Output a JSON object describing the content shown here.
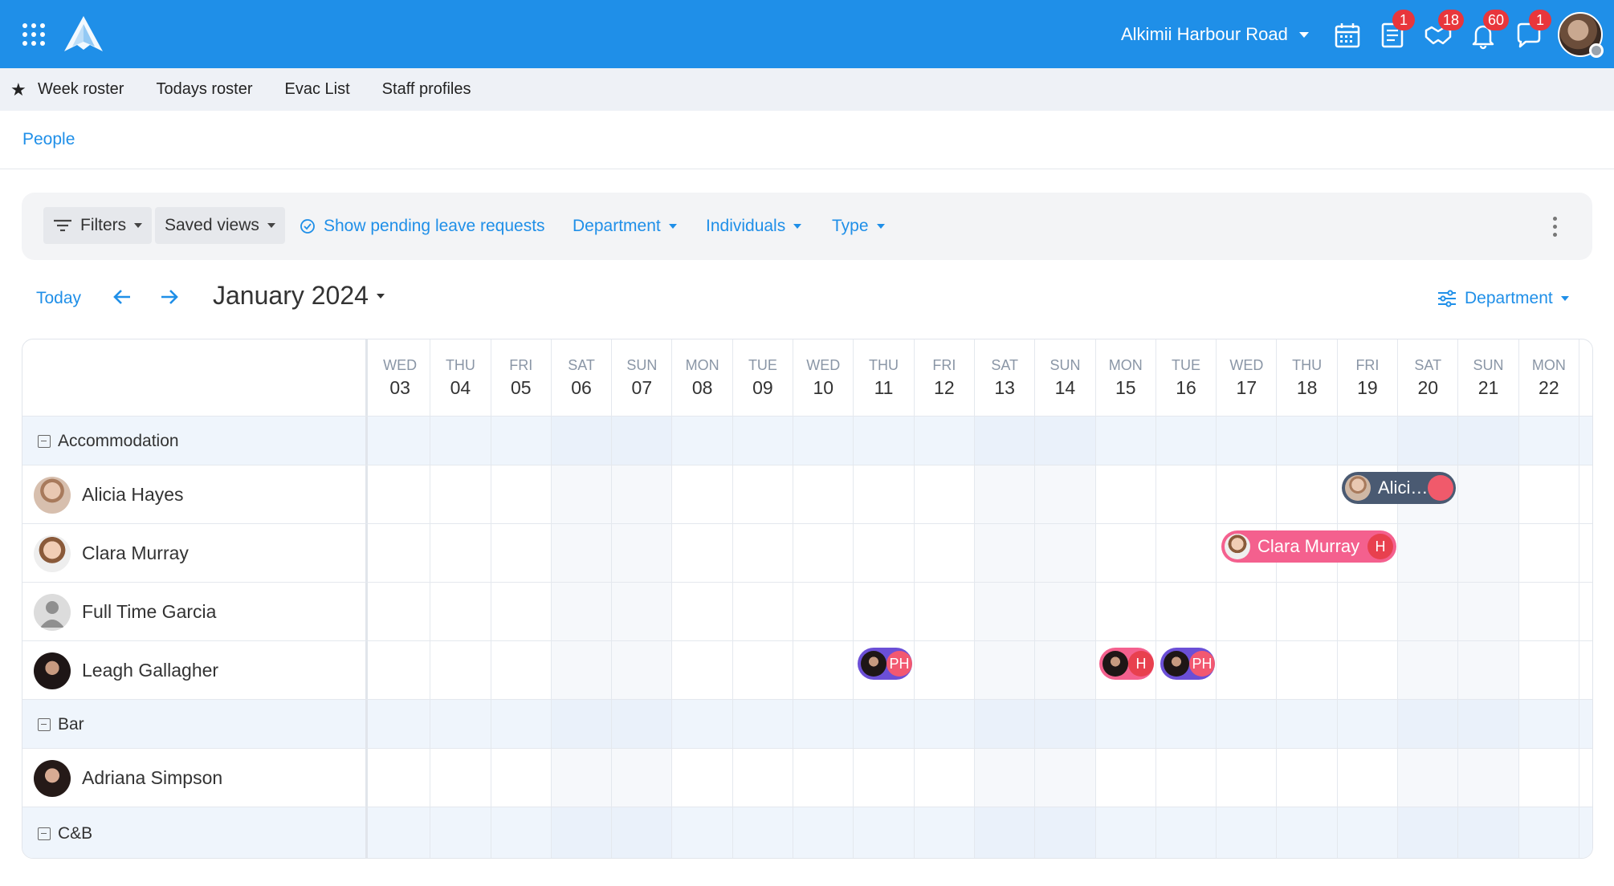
{
  "topbar": {
    "location": "Alkimii Harbour Road",
    "badges": {
      "calendar": "",
      "timesheet": "1",
      "handshake": "18",
      "bell": "60",
      "chat": "1"
    }
  },
  "nav": {
    "items": [
      "Week roster",
      "Todays roster",
      "Evac List",
      "Staff profiles"
    ]
  },
  "breadcrumb": "People",
  "filters": {
    "filters_label": "Filters",
    "saved_views_label": "Saved views",
    "pending_label": "Show pending leave requests",
    "department_label": "Department",
    "individuals_label": "Individuals",
    "type_label": "Type"
  },
  "calendar": {
    "today_label": "Today",
    "month_label": "January 2024",
    "group_by_label": "Department",
    "days": [
      {
        "dn": "WED",
        "dd": "03"
      },
      {
        "dn": "THU",
        "dd": "04"
      },
      {
        "dn": "FRI",
        "dd": "05"
      },
      {
        "dn": "SAT",
        "dd": "06"
      },
      {
        "dn": "SUN",
        "dd": "07"
      },
      {
        "dn": "MON",
        "dd": "08"
      },
      {
        "dn": "TUE",
        "dd": "09"
      },
      {
        "dn": "WED",
        "dd": "10"
      },
      {
        "dn": "THU",
        "dd": "11"
      },
      {
        "dn": "FRI",
        "dd": "12"
      },
      {
        "dn": "SAT",
        "dd": "13"
      },
      {
        "dn": "SUN",
        "dd": "14"
      },
      {
        "dn": "MON",
        "dd": "15"
      },
      {
        "dn": "TUE",
        "dd": "16"
      },
      {
        "dn": "WED",
        "dd": "17"
      },
      {
        "dn": "THU",
        "dd": "18"
      },
      {
        "dn": "FRI",
        "dd": "19"
      },
      {
        "dn": "SAT",
        "dd": "20"
      },
      {
        "dn": "SUN",
        "dd": "21"
      },
      {
        "dn": "MON",
        "dd": "22"
      }
    ],
    "groups": [
      "Accommodation",
      "Bar",
      "C&B"
    ],
    "people": [
      "Alicia Hayes",
      "Clara Murray",
      "Full Time Garcia",
      "Leagh Gallagher",
      "Adriana Simpson"
    ],
    "events": {
      "alicia": {
        "text": "Alici…",
        "color": "#4a5a72",
        "tag_color": "#f05a6b"
      },
      "clara": {
        "text": "Clara Murray",
        "tag": "H",
        "color": "#f4608e",
        "tag_color": "#e8404e"
      },
      "leagh_ph1": {
        "tag": "PH",
        "color": "#6b4fd6",
        "tag_color": "#f25870"
      },
      "leagh_h": {
        "tag": "H",
        "color": "#f4608e",
        "tag_color": "#e8404e"
      },
      "leagh_ph2": {
        "tag": "PH",
        "color": "#6b4fd6",
        "tag_color": "#f25870"
      }
    }
  }
}
